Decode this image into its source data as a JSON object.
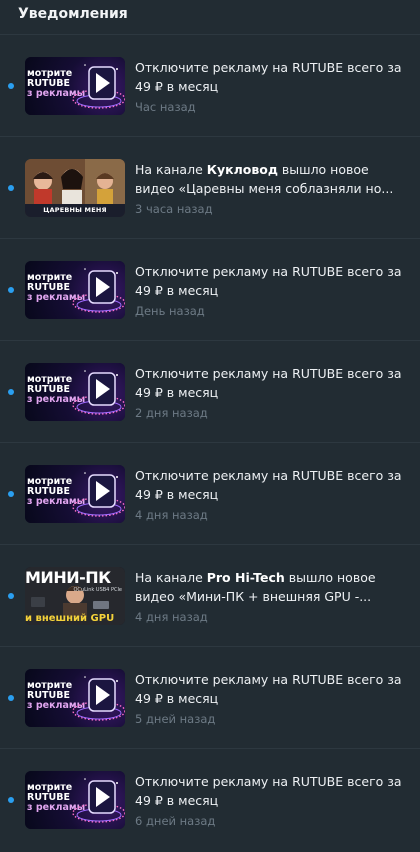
{
  "header": {
    "title": "Уведомления"
  },
  "promo_thumb": {
    "line1": "мотрите",
    "line2": "RUTUBE",
    "line3": "з рекламы"
  },
  "notifications": [
    {
      "kind": "promo",
      "text": "Отключите рекламу на RUTUBE всего за 49 ₽ в месяц",
      "time": "Час назад"
    },
    {
      "kind": "channel",
      "prefix": "На канале ",
      "channel": "Кукловод",
      "suffix": " вышло новое видео «Царевны меня соблазняли но...",
      "time": "3 часа назад",
      "thumb_caption": "ЦАРЕВНЫ МЕНЯ СОБЛАЗНЯЛИ"
    },
    {
      "kind": "promo",
      "text": "Отключите рекламу на RUTUBE всего за 49 ₽ в месяц",
      "time": "День назад"
    },
    {
      "kind": "promo",
      "text": "Отключите рекламу на RUTUBE всего за 49 ₽ в месяц",
      "time": "2 дня назад"
    },
    {
      "kind": "promo",
      "text": "Отключите рекламу на RUTUBE всего за 49 ₽ в месяц",
      "time": "4 дня назад"
    },
    {
      "kind": "channel",
      "prefix": "На канале ",
      "channel": "Pro Hi-Tech",
      "suffix": " вышло новое видео «Мини-ПК + внешняя GPU -...",
      "time": "4 дня назад",
      "thumb_big": "МИНИ-ПК",
      "thumb_sub": "и внешний GPU",
      "thumb_spec": "OCuLink USB4 PCIe"
    },
    {
      "kind": "promo",
      "text": "Отключите рекламу на RUTUBE всего за 49 ₽ в месяц",
      "time": "5 дней назад"
    },
    {
      "kind": "promo",
      "text": "Отключите рекламу на RUTUBE всего за 49 ₽ в месяц",
      "time": "6 дней назад"
    }
  ],
  "colors": {
    "background": "#222c33",
    "divider": "#2d3840",
    "unread_dot": "#2a9ff0",
    "time_text": "#6d7a85"
  }
}
